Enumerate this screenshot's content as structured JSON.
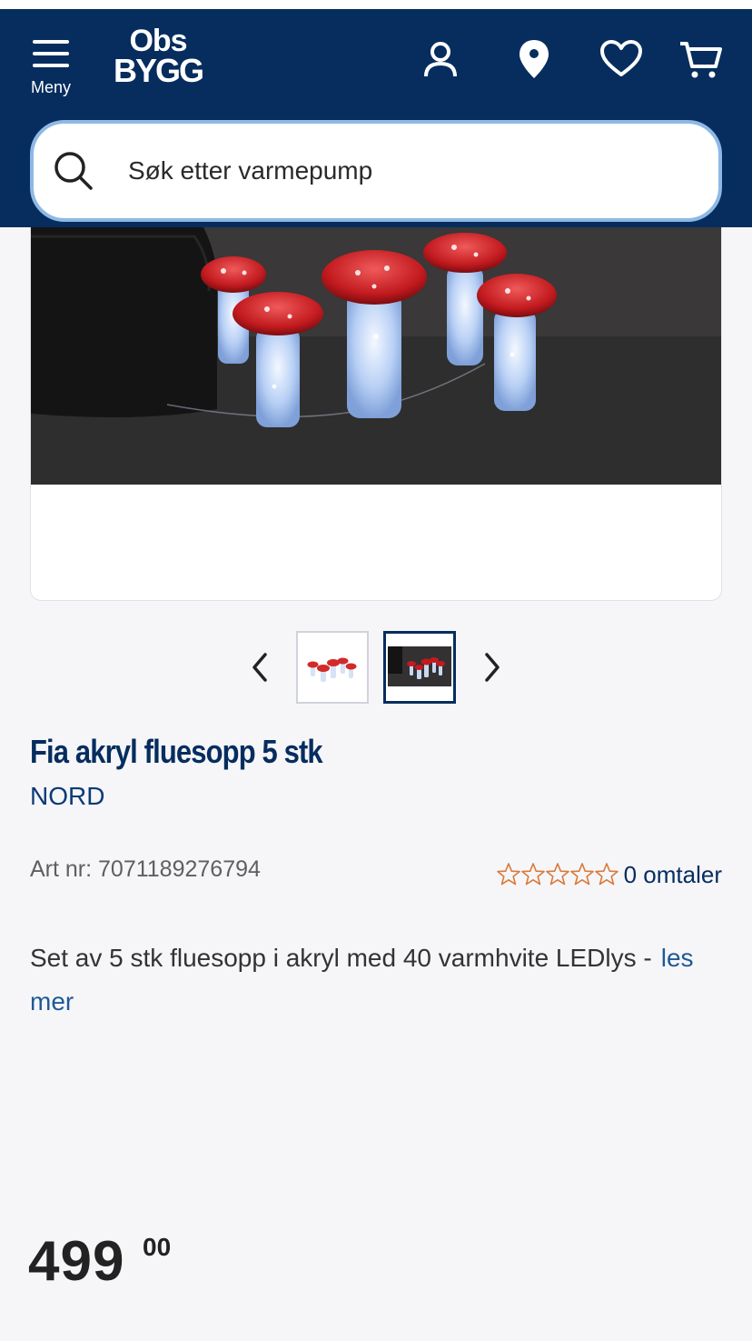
{
  "header": {
    "menu_label": "Meny",
    "logo_line1": "Obs",
    "logo_line2": "BYGG",
    "icons": [
      "user-icon",
      "location-pin-icon",
      "heart-icon",
      "cart-icon"
    ]
  },
  "search": {
    "placeholder": "Søk etter varmepump"
  },
  "gallery": {
    "thumbnails": [
      "product-thumbnail-1",
      "product-thumbnail-2"
    ],
    "selected_index": 1
  },
  "product": {
    "title": "Fia akryl fluesopp 5 stk",
    "brand": "NORD",
    "art_nr": "Art nr: 7071189276794",
    "rating": 0,
    "rating_max": 5,
    "reviews": "0 omtaler",
    "description": "Set av 5 stk fluesopp i akryl med 40 varmhvite LEDlys -",
    "read_more": "les mer",
    "price_int": "499",
    "price_dec": "00"
  },
  "colors": {
    "brand_navy": "#062d5e",
    "search_border": "#8eb9e4",
    "star_outline": "#d97a3a",
    "link": "#1f5a94"
  }
}
